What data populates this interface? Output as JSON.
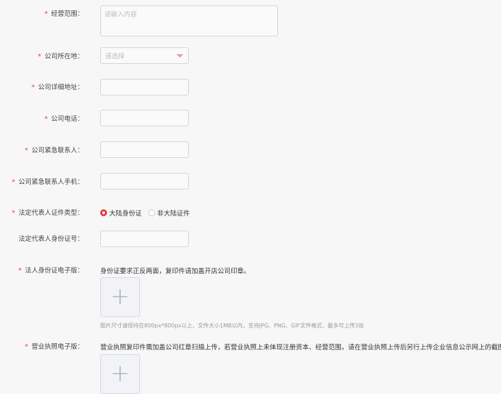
{
  "fields": {
    "scope": {
      "label": "经营范围：",
      "placeholder": "请输入内容"
    },
    "location": {
      "label": "公司所在地：",
      "placeholder": "请选择"
    },
    "address": {
      "label": "公司详细地址："
    },
    "phone": {
      "label": "公司电话："
    },
    "contact": {
      "label": "公司紧急联系人："
    },
    "contact_mobile": {
      "label": "公司紧急联系人手机："
    },
    "id_type": {
      "label": "法定代表人证件类型：",
      "options": [
        "大陆身份证",
        "非大陆证件"
      ],
      "selected": "大陆身份证"
    },
    "id_number": {
      "label": "法定代表人身份证号："
    },
    "id_image": {
      "label": "法人身份证电子版：",
      "note": "身份证要求正反两面，复印件请加盖开店公司印章。",
      "hint": "图片尺寸请保持在800px*800px以上，文件大小1MB以内，支持JPG、PNG、GIF文件格式，最多可上传3张"
    },
    "license_image": {
      "label": "营业执照电子版：",
      "note": "营业执照复印件需加盖公司红章扫描上传，若营业执照上未体现注册资本、经营范围，请在营业执照上传后另行上传企业信息公示网上的截图。"
    }
  },
  "required_mark": "*",
  "upload_symbol": "+"
}
